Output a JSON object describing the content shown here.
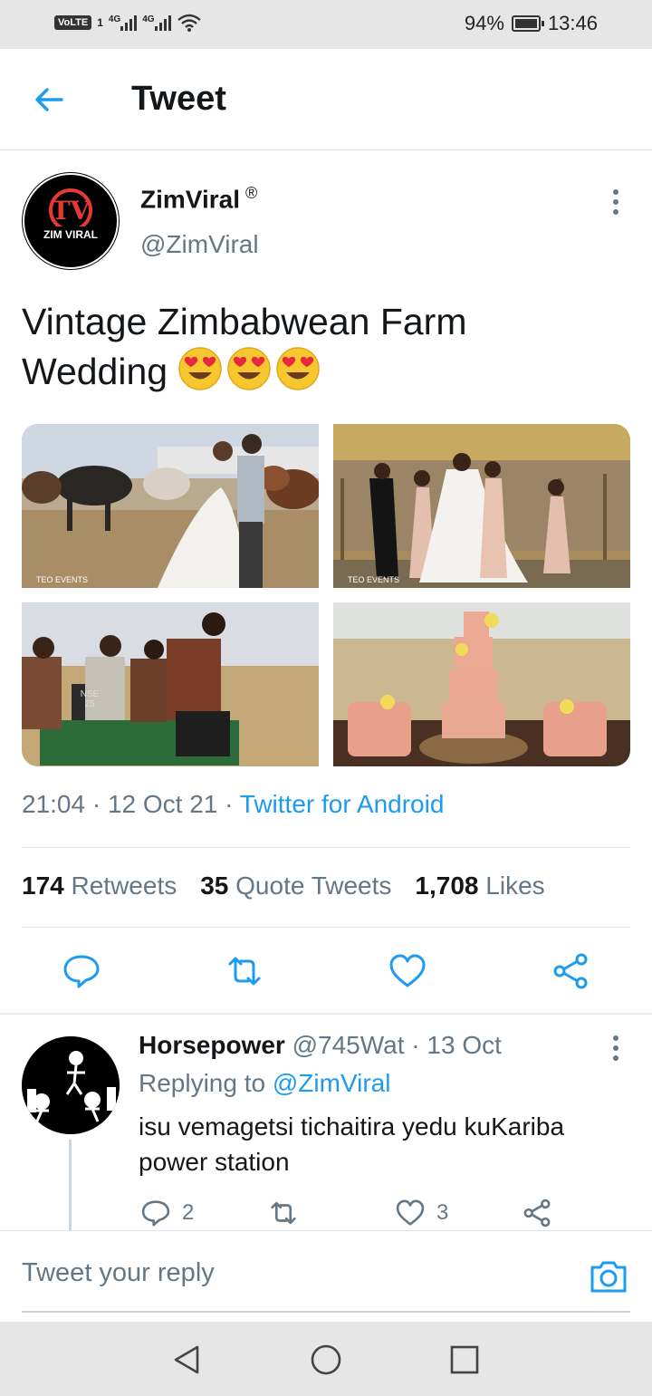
{
  "status_bar": {
    "volte": "VoLTE",
    "sim": "1",
    "net1": "4G",
    "net2": "4G",
    "battery": "94%",
    "time": "13:46"
  },
  "header": {
    "title": "Tweet"
  },
  "tweet": {
    "author_name": "ZimViral",
    "author_mark": "®",
    "author_handle": "@ZimViral",
    "avatar_text_top": "TV",
    "avatar_text_bottom": "ZIM VIRAL",
    "text": "Vintage Zimbabwean Farm Wedding",
    "emoji": [
      "heart-eyes-emoji",
      "heart-eyes-emoji",
      "heart-eyes-emoji"
    ],
    "photos": [
      {
        "name": "photo-couple-with-cattle",
        "watermark": "TEO EVENTS"
      },
      {
        "name": "photo-bridal-party",
        "watermark": "TEO EVENTS"
      },
      {
        "name": "photo-groomsmen-cart",
        "plate": "NSE 25"
      },
      {
        "name": "photo-wedding-cakes"
      }
    ],
    "time": "21:04",
    "date": "12 Oct 21",
    "source": "Twitter for Android",
    "stats": {
      "retweets_count": "174",
      "retweets_label": "Retweets",
      "quotes_count": "35",
      "quotes_label": "Quote Tweets",
      "likes_count": "1,708",
      "likes_label": "Likes"
    }
  },
  "reply": {
    "name": "Horsepower",
    "handle": "@745Wat",
    "date": "13 Oct",
    "replying_label": "Replying to",
    "replying_to": "@ZimViral",
    "text": "isu vemagetsi tichaitira yedu kuKariba power station",
    "reply_count": "2",
    "like_count": "3"
  },
  "compose": {
    "placeholder": "Tweet your reply"
  },
  "colors": {
    "accent": "#1d9bf0",
    "secondary_text": "#657786",
    "primary_text": "#14171a"
  }
}
